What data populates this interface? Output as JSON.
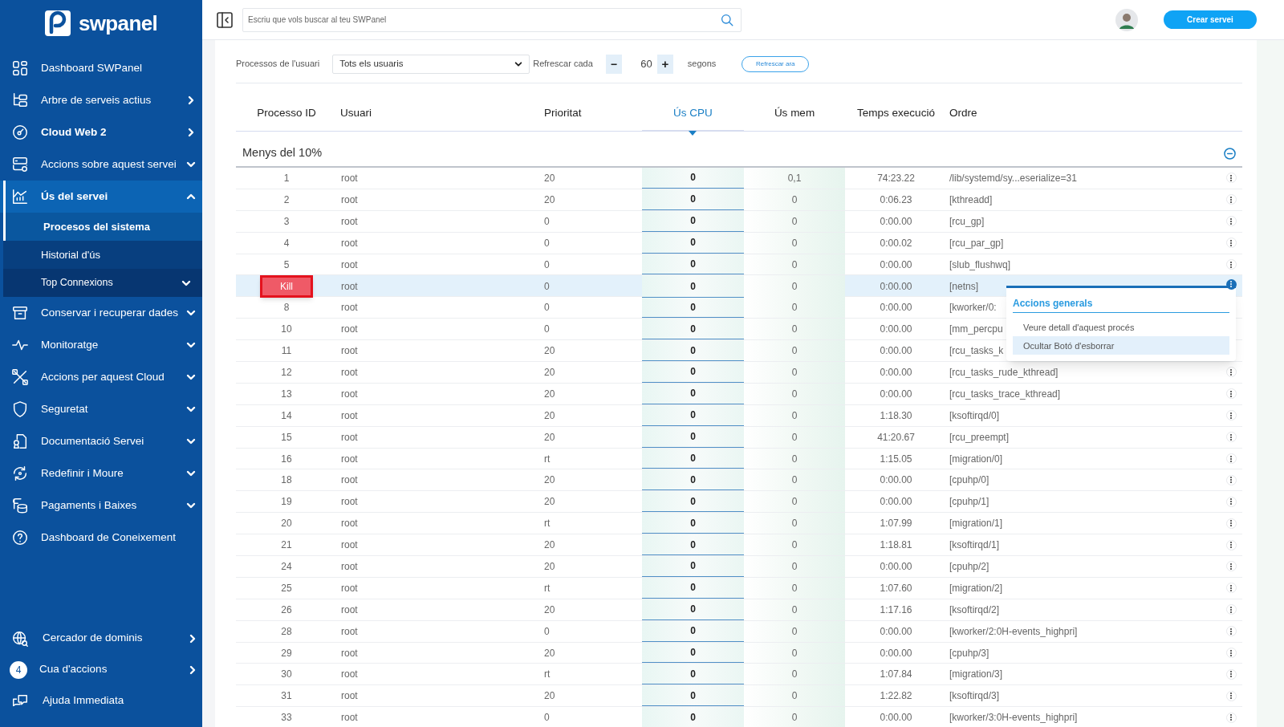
{
  "logo": {
    "text": "swpanel"
  },
  "sidebar": {
    "items": [
      {
        "label": "Dashboard SWPanel",
        "kind": "plain",
        "selected": false,
        "bold": false
      },
      {
        "label": "Arbre de serveis actius",
        "kind": "link",
        "selected": false,
        "bold": false
      },
      {
        "label": "Cloud Web 2",
        "kind": "link",
        "selected": false,
        "bold": true
      },
      {
        "label": "Accions sobre aquest servei",
        "kind": "group",
        "expanded": false,
        "selected": false,
        "bold": false
      },
      {
        "label": "Ús del servei",
        "kind": "group",
        "expanded": true,
        "selected": true,
        "bold": true,
        "children": [
          {
            "label": "Procesos del sistema",
            "kind": "plain",
            "selected": true
          },
          {
            "label": "Historial d'ús",
            "kind": "plain",
            "selected": false
          },
          {
            "label": "Top Connexions",
            "kind": "group",
            "expanded": false,
            "selected": false
          }
        ]
      },
      {
        "label": "Conservar i recuperar dades",
        "kind": "group",
        "expanded": false,
        "selected": false,
        "bold": false
      },
      {
        "label": "Monitoratge",
        "kind": "group",
        "expanded": false,
        "selected": false,
        "bold": false
      },
      {
        "label": "Accions per aquest Cloud",
        "kind": "group",
        "expanded": false,
        "selected": false,
        "bold": false
      },
      {
        "label": "Seguretat",
        "kind": "group",
        "expanded": false,
        "selected": false,
        "bold": false
      },
      {
        "label": "Documentació Servei",
        "kind": "group",
        "expanded": false,
        "selected": false,
        "bold": false
      },
      {
        "label": "Redefinir i Moure",
        "kind": "group",
        "expanded": false,
        "selected": false,
        "bold": false
      },
      {
        "label": "Pagaments i Baixes",
        "kind": "group",
        "expanded": false,
        "selected": false,
        "bold": false
      },
      {
        "label": "Dashboard de Coneixement",
        "kind": "plain",
        "selected": false,
        "bold": false
      }
    ],
    "bottom_items": [
      {
        "label": "Cercador de dominis",
        "kind": "link"
      },
      {
        "label": "Cua d'accions",
        "kind": "link",
        "badge": "4"
      },
      {
        "label": "Ajuda Immediata",
        "kind": "plain"
      }
    ]
  },
  "topbar": {
    "search_placeholder": "Escriu que vols buscar al teu SWPanel",
    "create_button": "Crear servei"
  },
  "filters": {
    "user_label": "Processos de l'usuari",
    "user_select": "Tots els usuaris",
    "refresh_label": "Refrescar cada",
    "minus": "−",
    "interval": "60",
    "plus": "+",
    "unit": "segons",
    "refresh_button": "Refrescar ara"
  },
  "table": {
    "columns": [
      {
        "label": "Processo ID",
        "sorted": false
      },
      {
        "label": "Usuari",
        "sorted": false
      },
      {
        "label": "Prioritat",
        "sorted": false
      },
      {
        "label": "Ús CPU",
        "sorted": true
      },
      {
        "label": "Ús mem",
        "sorted": false
      },
      {
        "label": "Temps execució",
        "sorted": false
      },
      {
        "label": "Ordre",
        "sorted": false
      }
    ],
    "group": {
      "title": "Menys del 10%",
      "expanded": true
    },
    "rows": [
      {
        "pid": "1",
        "user": "root",
        "priority": "20",
        "cpu": "0",
        "mem": "0,1",
        "time": "74:23.22",
        "command": "/lib/systemd/sy...eserialize=31",
        "selected": false,
        "menu_open": false
      },
      {
        "pid": "2",
        "user": "root",
        "priority": "20",
        "cpu": "0",
        "mem": "0",
        "time": "0:06.23",
        "command": "[kthreadd]",
        "selected": false,
        "menu_open": false
      },
      {
        "pid": "3",
        "user": "root",
        "priority": "0",
        "cpu": "0",
        "mem": "0",
        "time": "0:00.00",
        "command": "[rcu_gp]",
        "selected": false,
        "menu_open": false
      },
      {
        "pid": "4",
        "user": "root",
        "priority": "0",
        "cpu": "0",
        "mem": "0",
        "time": "0:00.02",
        "command": "[rcu_par_gp]",
        "selected": false,
        "menu_open": false
      },
      {
        "pid": "5",
        "user": "root",
        "priority": "0",
        "cpu": "0",
        "mem": "0",
        "time": "0:00.00",
        "command": "[slub_flushwq]",
        "selected": false,
        "menu_open": false
      },
      {
        "kill_button": "Kill",
        "user": "root",
        "priority": "0",
        "cpu": "0",
        "mem": "0",
        "time": "0:00.00",
        "command": "[netns]",
        "selected": true,
        "menu_open": true
      },
      {
        "pid": "8",
        "user": "root",
        "priority": "0",
        "cpu": "0",
        "mem": "0",
        "time": "0:00.00",
        "command": "[kworker/0:",
        "selected": false,
        "menu_open": false
      },
      {
        "pid": "10",
        "user": "root",
        "priority": "0",
        "cpu": "0",
        "mem": "0",
        "time": "0:00.00",
        "command": "[mm_percpu",
        "selected": false,
        "menu_open": false
      },
      {
        "pid": "11",
        "user": "root",
        "priority": "20",
        "cpu": "0",
        "mem": "0",
        "time": "0:00.00",
        "command": "[rcu_tasks_k",
        "selected": false,
        "menu_open": false
      },
      {
        "pid": "12",
        "user": "root",
        "priority": "20",
        "cpu": "0",
        "mem": "0",
        "time": "0:00.00",
        "command": "[rcu_tasks_rude_kthread]",
        "selected": false,
        "menu_open": false
      },
      {
        "pid": "13",
        "user": "root",
        "priority": "20",
        "cpu": "0",
        "mem": "0",
        "time": "0:00.00",
        "command": "[rcu_tasks_trace_kthread]",
        "selected": false,
        "menu_open": false
      },
      {
        "pid": "14",
        "user": "root",
        "priority": "20",
        "cpu": "0",
        "mem": "0",
        "time": "1:18.30",
        "command": "[ksoftirqd/0]",
        "selected": false,
        "menu_open": false
      },
      {
        "pid": "15",
        "user": "root",
        "priority": "20",
        "cpu": "0",
        "mem": "0",
        "time": "41:20.67",
        "command": "[rcu_preempt]",
        "selected": false,
        "menu_open": false
      },
      {
        "pid": "16",
        "user": "root",
        "priority": "rt",
        "cpu": "0",
        "mem": "0",
        "time": "1:15.05",
        "command": "[migration/0]",
        "selected": false,
        "menu_open": false
      },
      {
        "pid": "18",
        "user": "root",
        "priority": "20",
        "cpu": "0",
        "mem": "0",
        "time": "0:00.00",
        "command": "[cpuhp/0]",
        "selected": false,
        "menu_open": false
      },
      {
        "pid": "19",
        "user": "root",
        "priority": "20",
        "cpu": "0",
        "mem": "0",
        "time": "0:00.00",
        "command": "[cpuhp/1]",
        "selected": false,
        "menu_open": false
      },
      {
        "pid": "20",
        "user": "root",
        "priority": "rt",
        "cpu": "0",
        "mem": "0",
        "time": "1:07.99",
        "command": "[migration/1]",
        "selected": false,
        "menu_open": false
      },
      {
        "pid": "21",
        "user": "root",
        "priority": "20",
        "cpu": "0",
        "mem": "0",
        "time": "1:18.81",
        "command": "[ksoftirqd/1]",
        "selected": false,
        "menu_open": false
      },
      {
        "pid": "24",
        "user": "root",
        "priority": "20",
        "cpu": "0",
        "mem": "0",
        "time": "0:00.00",
        "command": "[cpuhp/2]",
        "selected": false,
        "menu_open": false
      },
      {
        "pid": "25",
        "user": "root",
        "priority": "rt",
        "cpu": "0",
        "mem": "0",
        "time": "1:07.60",
        "command": "[migration/2]",
        "selected": false,
        "menu_open": false
      },
      {
        "pid": "26",
        "user": "root",
        "priority": "20",
        "cpu": "0",
        "mem": "0",
        "time": "1:17.16",
        "command": "[ksoftirqd/2]",
        "selected": false,
        "menu_open": false
      },
      {
        "pid": "28",
        "user": "root",
        "priority": "0",
        "cpu": "0",
        "mem": "0",
        "time": "0:00.00",
        "command": "[kworker/2:0H-events_highpri]",
        "selected": false,
        "menu_open": false
      },
      {
        "pid": "29",
        "user": "root",
        "priority": "20",
        "cpu": "0",
        "mem": "0",
        "time": "0:00.00",
        "command": "[cpuhp/3]",
        "selected": false,
        "menu_open": false
      },
      {
        "pid": "30",
        "user": "root",
        "priority": "rt",
        "cpu": "0",
        "mem": "0",
        "time": "1:07.84",
        "command": "[migration/3]",
        "selected": false,
        "menu_open": false
      },
      {
        "pid": "31",
        "user": "root",
        "priority": "20",
        "cpu": "0",
        "mem": "0",
        "time": "1:22.82",
        "command": "[ksoftirqd/3]",
        "selected": false,
        "menu_open": false
      },
      {
        "pid": "33",
        "user": "root",
        "priority": "0",
        "cpu": "0",
        "mem": "0",
        "time": "0:00.00",
        "command": "[kworker/3:0H-events_highpri]",
        "selected": false,
        "menu_open": false
      }
    ]
  },
  "row_menu": {
    "title": "Accions generals",
    "items": [
      {
        "label": "Veure detall d'aquest procés",
        "selected": false
      },
      {
        "label": "Ocultar Botó d'esborrar",
        "selected": true
      }
    ]
  }
}
